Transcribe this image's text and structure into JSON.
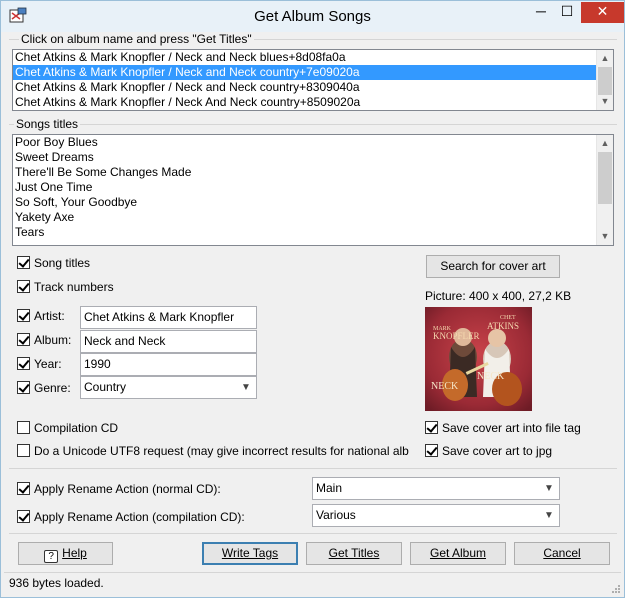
{
  "window": {
    "title": "Get Album Songs",
    "min": "─",
    "max": "☐",
    "close": "✕"
  },
  "albums": {
    "group_label": "Click on album name and press \"Get Titles\"",
    "items": [
      "Chet Atkins & Mark Knopfler / Neck and Neck blues+8d08fa0a",
      "Chet Atkins & Mark Knopfler / Neck and Neck country+7e09020a",
      "Chet Atkins & Mark Knopfler / Neck and Neck country+8309040a",
      "Chet Atkins & Mark Knopfler / Neck And Neck country+8509020a"
    ],
    "selected_index": 1
  },
  "songs": {
    "group_label": "Songs titles",
    "items": [
      "Poor Boy Blues",
      "Sweet Dreams",
      "There'll Be Some Changes Made",
      "Just One Time",
      "So Soft, Your Goodbye",
      "Yakety Axe",
      "Tears"
    ]
  },
  "options": {
    "song_titles": {
      "label": "Song titles",
      "checked": true
    },
    "track_numbers": {
      "label": "Track numbers",
      "checked": true
    },
    "artist": {
      "label": "Artist:",
      "checked": true,
      "value": "Chet Atkins & Mark Knopfler"
    },
    "album": {
      "label": "Album:",
      "checked": true,
      "value": "Neck and Neck"
    },
    "year": {
      "label": "Year:",
      "checked": true,
      "value": "1990"
    },
    "genre": {
      "label": "Genre:",
      "checked": true,
      "value": "Country"
    },
    "compilation": {
      "label": "Compilation CD",
      "checked": false
    },
    "unicode": {
      "label": "Do a Unicode UTF8 request (may give incorrect results for national alb",
      "checked": false
    }
  },
  "cover": {
    "search_button": "Search for cover art",
    "picture_info": "Picture: 400 x 400, 27,2 KB",
    "save_into_tag": {
      "label": "Save cover art into file tag",
      "checked": true
    },
    "save_to_jpg": {
      "label": "Save cover art to jpg",
      "checked": true
    },
    "art_text_left_top": "MARK",
    "art_text_left": "KNOPFLER",
    "art_text_right_top": "CHET",
    "art_text_right": "ATKINS",
    "art_text_bottom_left": "NECK",
    "art_text_bottom_right": "NECK"
  },
  "rename": {
    "normal": {
      "label": "Apply Rename Action (normal CD):",
      "checked": true,
      "value": "Main"
    },
    "compilation": {
      "label": "Apply Rename Action (compilation CD):",
      "checked": true,
      "value": "Various"
    }
  },
  "buttons": {
    "help": "Help",
    "write_tags": "Write Tags",
    "get_titles": "Get Titles",
    "get_album": "Get Album",
    "cancel": "Cancel"
  },
  "status": "936 bytes loaded.",
  "colors": {
    "selection": "#3399ff",
    "close_button": "#c7392c"
  }
}
